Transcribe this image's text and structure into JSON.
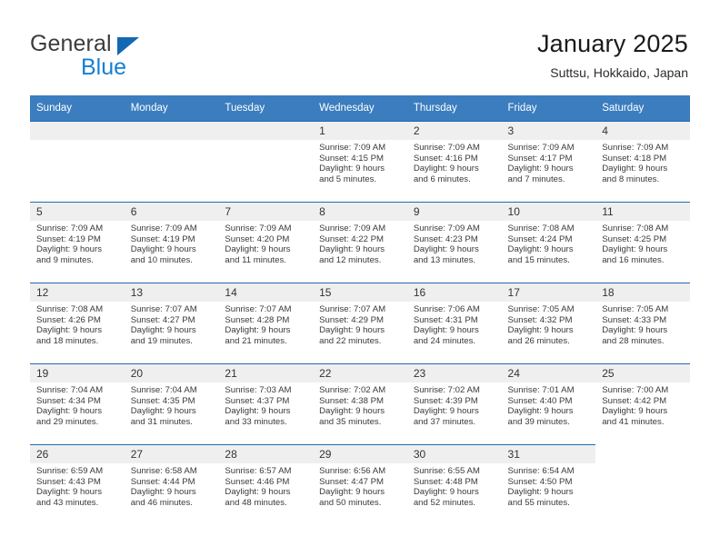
{
  "brand": {
    "line1": "General",
    "line2": "Blue"
  },
  "header": {
    "title": "January 2025",
    "subtitle": "Suttsu, Hokkaido, Japan"
  },
  "colors": {
    "header_blue": "#3b7dbe",
    "rule_blue": "#1f6cb0",
    "daynum_bg": "#efefef",
    "brand_blue": "#1580d4"
  },
  "weekdays": [
    "Sunday",
    "Monday",
    "Tuesday",
    "Wednesday",
    "Thursday",
    "Friday",
    "Saturday"
  ],
  "weeks": [
    [
      {
        "day": "",
        "lines": []
      },
      {
        "day": "",
        "lines": []
      },
      {
        "day": "",
        "lines": []
      },
      {
        "day": "1",
        "lines": [
          "Sunrise: 7:09 AM",
          "Sunset: 4:15 PM",
          "Daylight: 9 hours",
          "and 5 minutes."
        ]
      },
      {
        "day": "2",
        "lines": [
          "Sunrise: 7:09 AM",
          "Sunset: 4:16 PM",
          "Daylight: 9 hours",
          "and 6 minutes."
        ]
      },
      {
        "day": "3",
        "lines": [
          "Sunrise: 7:09 AM",
          "Sunset: 4:17 PM",
          "Daylight: 9 hours",
          "and 7 minutes."
        ]
      },
      {
        "day": "4",
        "lines": [
          "Sunrise: 7:09 AM",
          "Sunset: 4:18 PM",
          "Daylight: 9 hours",
          "and 8 minutes."
        ]
      }
    ],
    [
      {
        "day": "5",
        "lines": [
          "Sunrise: 7:09 AM",
          "Sunset: 4:19 PM",
          "Daylight: 9 hours",
          "and 9 minutes."
        ]
      },
      {
        "day": "6",
        "lines": [
          "Sunrise: 7:09 AM",
          "Sunset: 4:19 PM",
          "Daylight: 9 hours",
          "and 10 minutes."
        ]
      },
      {
        "day": "7",
        "lines": [
          "Sunrise: 7:09 AM",
          "Sunset: 4:20 PM",
          "Daylight: 9 hours",
          "and 11 minutes."
        ]
      },
      {
        "day": "8",
        "lines": [
          "Sunrise: 7:09 AM",
          "Sunset: 4:22 PM",
          "Daylight: 9 hours",
          "and 12 minutes."
        ]
      },
      {
        "day": "9",
        "lines": [
          "Sunrise: 7:09 AM",
          "Sunset: 4:23 PM",
          "Daylight: 9 hours",
          "and 13 minutes."
        ]
      },
      {
        "day": "10",
        "lines": [
          "Sunrise: 7:08 AM",
          "Sunset: 4:24 PM",
          "Daylight: 9 hours",
          "and 15 minutes."
        ]
      },
      {
        "day": "11",
        "lines": [
          "Sunrise: 7:08 AM",
          "Sunset: 4:25 PM",
          "Daylight: 9 hours",
          "and 16 minutes."
        ]
      }
    ],
    [
      {
        "day": "12",
        "lines": [
          "Sunrise: 7:08 AM",
          "Sunset: 4:26 PM",
          "Daylight: 9 hours",
          "and 18 minutes."
        ]
      },
      {
        "day": "13",
        "lines": [
          "Sunrise: 7:07 AM",
          "Sunset: 4:27 PM",
          "Daylight: 9 hours",
          "and 19 minutes."
        ]
      },
      {
        "day": "14",
        "lines": [
          "Sunrise: 7:07 AM",
          "Sunset: 4:28 PM",
          "Daylight: 9 hours",
          "and 21 minutes."
        ]
      },
      {
        "day": "15",
        "lines": [
          "Sunrise: 7:07 AM",
          "Sunset: 4:29 PM",
          "Daylight: 9 hours",
          "and 22 minutes."
        ]
      },
      {
        "day": "16",
        "lines": [
          "Sunrise: 7:06 AM",
          "Sunset: 4:31 PM",
          "Daylight: 9 hours",
          "and 24 minutes."
        ]
      },
      {
        "day": "17",
        "lines": [
          "Sunrise: 7:05 AM",
          "Sunset: 4:32 PM",
          "Daylight: 9 hours",
          "and 26 minutes."
        ]
      },
      {
        "day": "18",
        "lines": [
          "Sunrise: 7:05 AM",
          "Sunset: 4:33 PM",
          "Daylight: 9 hours",
          "and 28 minutes."
        ]
      }
    ],
    [
      {
        "day": "19",
        "lines": [
          "Sunrise: 7:04 AM",
          "Sunset: 4:34 PM",
          "Daylight: 9 hours",
          "and 29 minutes."
        ]
      },
      {
        "day": "20",
        "lines": [
          "Sunrise: 7:04 AM",
          "Sunset: 4:35 PM",
          "Daylight: 9 hours",
          "and 31 minutes."
        ]
      },
      {
        "day": "21",
        "lines": [
          "Sunrise: 7:03 AM",
          "Sunset: 4:37 PM",
          "Daylight: 9 hours",
          "and 33 minutes."
        ]
      },
      {
        "day": "22",
        "lines": [
          "Sunrise: 7:02 AM",
          "Sunset: 4:38 PM",
          "Daylight: 9 hours",
          "and 35 minutes."
        ]
      },
      {
        "day": "23",
        "lines": [
          "Sunrise: 7:02 AM",
          "Sunset: 4:39 PM",
          "Daylight: 9 hours",
          "and 37 minutes."
        ]
      },
      {
        "day": "24",
        "lines": [
          "Sunrise: 7:01 AM",
          "Sunset: 4:40 PM",
          "Daylight: 9 hours",
          "and 39 minutes."
        ]
      },
      {
        "day": "25",
        "lines": [
          "Sunrise: 7:00 AM",
          "Sunset: 4:42 PM",
          "Daylight: 9 hours",
          "and 41 minutes."
        ]
      }
    ],
    [
      {
        "day": "26",
        "lines": [
          "Sunrise: 6:59 AM",
          "Sunset: 4:43 PM",
          "Daylight: 9 hours",
          "and 43 minutes."
        ]
      },
      {
        "day": "27",
        "lines": [
          "Sunrise: 6:58 AM",
          "Sunset: 4:44 PM",
          "Daylight: 9 hours",
          "and 46 minutes."
        ]
      },
      {
        "day": "28",
        "lines": [
          "Sunrise: 6:57 AM",
          "Sunset: 4:46 PM",
          "Daylight: 9 hours",
          "and 48 minutes."
        ]
      },
      {
        "day": "29",
        "lines": [
          "Sunrise: 6:56 AM",
          "Sunset: 4:47 PM",
          "Daylight: 9 hours",
          "and 50 minutes."
        ]
      },
      {
        "day": "30",
        "lines": [
          "Sunrise: 6:55 AM",
          "Sunset: 4:48 PM",
          "Daylight: 9 hours",
          "and 52 minutes."
        ]
      },
      {
        "day": "31",
        "lines": [
          "Sunrise: 6:54 AM",
          "Sunset: 4:50 PM",
          "Daylight: 9 hours",
          "and 55 minutes."
        ]
      },
      {
        "day": "",
        "lines": []
      }
    ]
  ]
}
